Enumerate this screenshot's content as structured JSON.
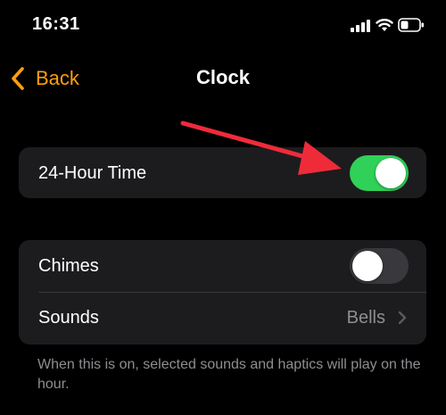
{
  "status_bar": {
    "time": "16:31",
    "icons": [
      "signal-icon",
      "wifi-icon",
      "battery-icon"
    ]
  },
  "nav": {
    "back_label": "Back",
    "title": "Clock",
    "accent_color": "#ff9f0a"
  },
  "settings": {
    "twenty_four_hour": {
      "label": "24-Hour Time",
      "enabled": true
    },
    "chimes": {
      "label": "Chimes",
      "enabled": false
    },
    "sounds": {
      "label": "Sounds",
      "value": "Bells"
    }
  },
  "footer_note": "When this is on, selected sounds and haptics will play on the hour.",
  "colors": {
    "background": "#000000",
    "card": "#1c1c1e",
    "toggle_on": "#30d158",
    "toggle_off": "#39393d",
    "secondary_text": "#8e8e93",
    "annotation_arrow": "#ef2b3a"
  }
}
